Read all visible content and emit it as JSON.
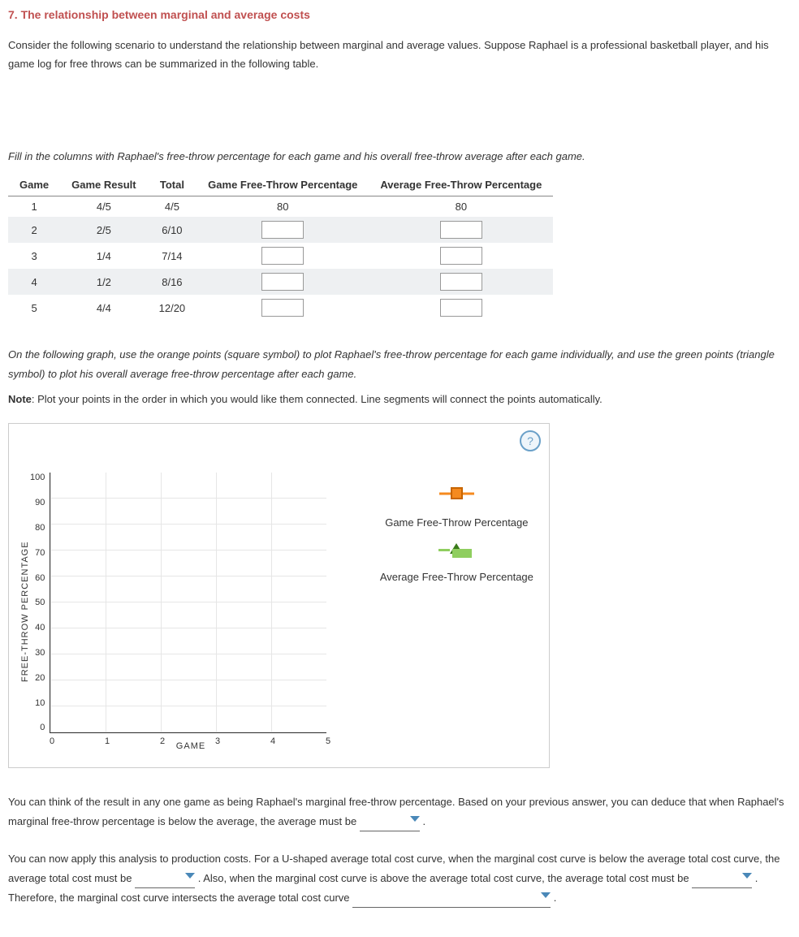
{
  "heading": "7. The relationship between marginal and average costs",
  "intro": "Consider the following scenario to understand the relationship between marginal and average values. Suppose Raphael is a professional basketball player, and his game log for free throws can be summarized in the following table.",
  "table_instruction": "Fill in the columns with Raphael's free-throw percentage for each game and his overall free-throw average after each game.",
  "table": {
    "headers": [
      "Game",
      "Game Result",
      "Total",
      "Game Free-Throw Percentage",
      "Average Free-Throw Percentage"
    ],
    "rows": [
      {
        "game": "1",
        "result": "4/5",
        "total": "4/5",
        "game_pct": "80",
        "avg_pct": "80",
        "input": false
      },
      {
        "game": "2",
        "result": "2/5",
        "total": "6/10",
        "game_pct": "",
        "avg_pct": "",
        "input": true
      },
      {
        "game": "3",
        "result": "1/4",
        "total": "7/14",
        "game_pct": "",
        "avg_pct": "",
        "input": true
      },
      {
        "game": "4",
        "result": "1/2",
        "total": "8/16",
        "game_pct": "",
        "avg_pct": "",
        "input": true
      },
      {
        "game": "5",
        "result": "4/4",
        "total": "12/20",
        "game_pct": "",
        "avg_pct": "",
        "input": true
      }
    ]
  },
  "graph_instruction": "On the following graph, use the orange points (square symbol) to plot Raphael's free-throw percentage for each game individually, and use the green points (triangle symbol) to plot his overall average free-throw percentage after each game.",
  "graph_note_label": "Note",
  "graph_note": ": Plot your points in the order in which you would like them connected. Line segments will connect the points automatically.",
  "help": "?",
  "chart_data": {
    "type": "scatter",
    "title": "",
    "xlabel": "GAME",
    "ylabel": "FREE-THROW PERCENTAGE",
    "xlim": [
      0,
      5
    ],
    "ylim": [
      0,
      100
    ],
    "xticks": [
      "0",
      "1",
      "2",
      "3",
      "4",
      "5"
    ],
    "yticks": [
      "100",
      "90",
      "80",
      "70",
      "60",
      "50",
      "40",
      "30",
      "20",
      "10",
      "0"
    ],
    "series": [
      {
        "name": "Game Free-Throw Percentage",
        "symbol": "orange-square",
        "values": []
      },
      {
        "name": "Average Free-Throw Percentage",
        "symbol": "green-triangle",
        "values": []
      }
    ]
  },
  "para1_a": "You can think of the result in any one game as being Raphael's marginal free-throw percentage. Based on your previous answer, you can deduce that when Raphael's marginal free-throw percentage is below the average, the average must be ",
  "para1_b": " .",
  "para2_a": "You can now apply this analysis to production costs. For a U-shaped average total cost curve, when the marginal cost curve is below the average total cost curve, the average total cost must be ",
  "para2_b": " . Also, when the marginal cost curve is above the average total cost curve, the average total cost must be ",
  "para2_c": " . Therefore, the marginal cost curve intersects the average total cost curve ",
  "para2_d": " ."
}
